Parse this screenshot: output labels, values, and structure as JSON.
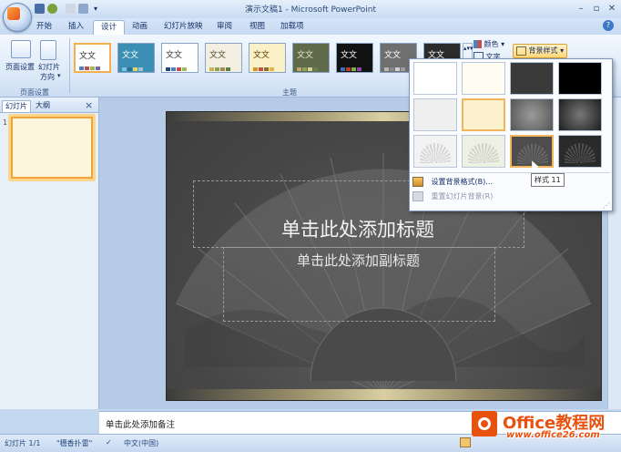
{
  "window": {
    "title": "演示文稿1 - Microsoft PowerPoint",
    "controls": [
      "–",
      "▫",
      "✕"
    ]
  },
  "ribbon": {
    "tabs": [
      "开始",
      "插入",
      "设计",
      "动画",
      "幻灯片放映",
      "审阅",
      "视图",
      "加载项"
    ],
    "active_tab": "设计",
    "page_setup": {
      "page_setup_label": "页面设置",
      "orientation_label": "幻灯片",
      "orientation_label2": "方向",
      "group_label": "页面设置"
    },
    "themes": {
      "group_label": "主题",
      "items": [
        {
          "text": "文文",
          "bg": "#ffffff",
          "fg": "#333333",
          "dots": [
            "#4f81bd",
            "#c0504d",
            "#9bbb59",
            "#8064a2"
          ],
          "selected": true
        },
        {
          "text": "文文",
          "bg": "#3c8fb4",
          "fg": "#ffffff",
          "dots": [
            "#76c4e6",
            "#2e6e8e",
            "#e7d26a",
            "#9cc6d8"
          ]
        },
        {
          "text": "文文",
          "bg": "#ffffff",
          "fg": "#333333",
          "dots": [
            "#1f497d",
            "#4f81bd",
            "#c0504d",
            "#9bbb59"
          ]
        },
        {
          "text": "文文",
          "bg": "#f2efe2",
          "fg": "#4a4a2a",
          "dots": [
            "#c8b456",
            "#8aa14f",
            "#a38a56",
            "#5e7f3c"
          ]
        },
        {
          "text": "文文",
          "bg": "#fbf1c9",
          "fg": "#5a3c00",
          "dots": [
            "#d6902e",
            "#c0504d",
            "#8f6c2c",
            "#e5b24e"
          ]
        },
        {
          "text": "文文",
          "bg": "#5f6a4a",
          "fg": "#e9e6c9",
          "dots": [
            "#b9a96c",
            "#8ca060",
            "#d8cf9d",
            "#6b7f4e"
          ]
        },
        {
          "text": "文文",
          "bg": "#111111",
          "fg": "#ffffff",
          "dots": [
            "#3b6fb6",
            "#c0392b",
            "#7fb241",
            "#8e44ad"
          ]
        },
        {
          "text": "文文",
          "bg": "#6f6f6f",
          "fg": "#ffffff",
          "dots": [
            "#b5b5b5",
            "#8a8a8a",
            "#d0d0d0",
            "#9c9c9c"
          ]
        },
        {
          "text": "文文",
          "bg": "#2b2b2b",
          "fg": "#ffffff",
          "dots": [
            "#5a5a5a",
            "#8e8e8e",
            "#c4c4c4",
            "#444444"
          ]
        }
      ]
    },
    "colors_label": "颜色",
    "fonts_label": "文字",
    "bg_styles_label": "背景样式"
  },
  "left_pane": {
    "tabs": [
      "幻灯片",
      "大纲"
    ],
    "slide_number": "1"
  },
  "slide": {
    "title_placeholder": "单击此处添加标题",
    "subtitle_placeholder": "单击此处添加副标题"
  },
  "notes": {
    "placeholder": "单击此处添加备注"
  },
  "status": {
    "slide_info": "幻灯片 1/1",
    "theme": "\"穗香扑雷\"",
    "language": "中文(中国)"
  },
  "background_gallery": {
    "swatches": [
      {
        "bg": "#ffffff"
      },
      {
        "bg": "#fffdf2"
      },
      {
        "bg": "#3a3a3a"
      },
      {
        "bg": "#000000"
      },
      {
        "bg": "#efefef"
      },
      {
        "bg": "#fbf1ce",
        "highlight": true
      },
      {
        "bg": "#555555"
      },
      {
        "bg": "#1e1e1e"
      },
      {
        "bg": "#f3f3f3"
      },
      {
        "bg": "#eef0e4"
      },
      {
        "bg": "#4d4d4d",
        "highlight": true
      },
      {
        "bg": "#2a2a2a"
      }
    ],
    "format_background": "设置背景格式(B)...",
    "reset_background": "重置幻灯片背景(R)",
    "tooltip": "样式 11"
  },
  "watermark": {
    "title": "Office教程网",
    "url": "www.office26.com"
  }
}
